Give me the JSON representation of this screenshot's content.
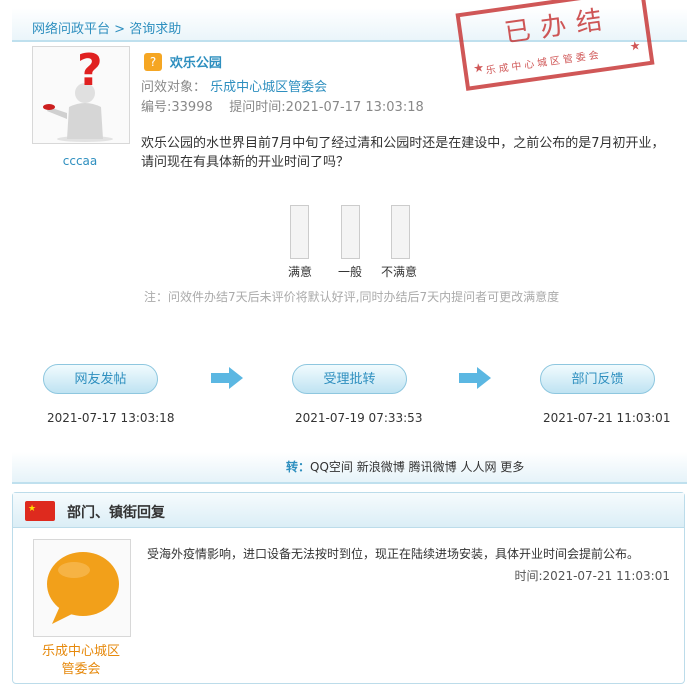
{
  "breadcrumb": {
    "home": "网络问政平台",
    "sep": " > ",
    "current": "咨询求助"
  },
  "stamp": {
    "title": "已办结",
    "subtitle": "乐成中心城区管委会"
  },
  "question": {
    "user": "cccaa",
    "title": "欢乐公园",
    "target_label": "问效对象：",
    "target": "乐成中心城区管委会",
    "id_label": "编号:",
    "id": "33998",
    "time_label": "提问时间:",
    "time": "2021-07-17 13:03:18",
    "content": "欢乐公园的水世界目前7月中旬了经过清和公园时还是在建设中，之前公布的是7月初开业，请问现在有具体新的开业时间了吗？"
  },
  "rating": {
    "options": [
      "满意",
      "一般",
      "不满意"
    ],
    "note": "注：问效件办结7天后未评价将默认好评,同时办结后7天内提问者可更改满意度"
  },
  "flow": [
    {
      "label": "网友发帖",
      "time": "2021-07-17 13:03:18"
    },
    {
      "label": "受理批转",
      "time": "2021-07-19 07:33:53"
    },
    {
      "label": "部门反馈",
      "time": "2021-07-21 11:03:01"
    }
  ],
  "share": {
    "label": "转：",
    "links": [
      "QQ空间",
      "新浪微博",
      "腾讯微博",
      "人人网",
      "更多"
    ]
  },
  "reply": {
    "section_title": "部门、镇街回复",
    "dept_line1": "乐成中心城区",
    "dept_line2": "管委会",
    "text": "受海外疫情影响，进口设备无法按时到位，现正在陆续进场安装，具体开业时间会提前公布。",
    "time_label": "时间:",
    "time": "2021-07-21 11:03:01"
  },
  "colors": {
    "link_blue": "#2e8fbf",
    "stamp_red": "#c83a3a",
    "dept_orange": "#e6890c"
  }
}
